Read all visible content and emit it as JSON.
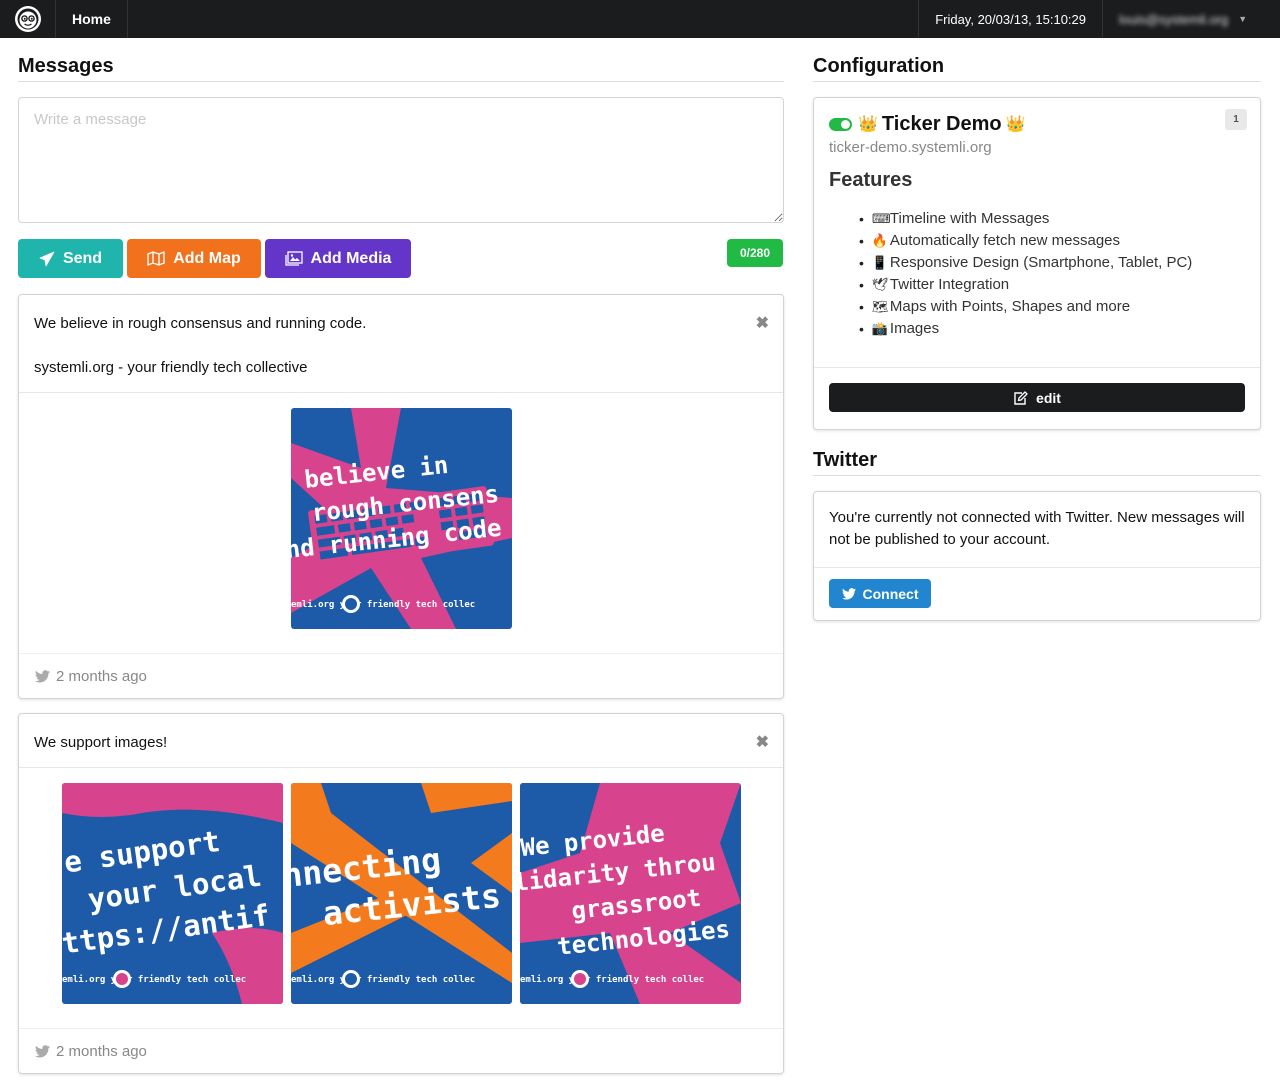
{
  "nav": {
    "home_label": "Home",
    "datetime": "Friday, 20/03/13, 15:10:29",
    "user_email": "louis@systemli.org",
    "logo_icon": "systemli-logo-icon"
  },
  "messages": {
    "title": "Messages",
    "placeholder": "Write a message",
    "send_label": "Send",
    "add_map_label": "Add Map",
    "add_media_label": "Add Media",
    "char_counter": "0/280",
    "colors": {
      "send": "#1fb5ac",
      "map": "#f2711c",
      "media": "#6435c9",
      "counter": "#21ba45"
    },
    "items": [
      {
        "line1": "We believe in rough consensus and running code.",
        "line2": "systemli.org - your friendly tech collective",
        "images": [
          {
            "lines": [
              "believe in",
              "rough consens",
              "nd running code"
            ],
            "footer": "emli.org  your friendly tech collec"
          }
        ],
        "time": "2 months ago"
      },
      {
        "line1": "We support images!",
        "images": [
          {
            "lines": [
              "Ve support",
              "your local",
              "ttps://antif"
            ],
            "footer": "emli.org  your friendly tech collec"
          },
          {
            "lines": [
              "nnecting",
              "activists"
            ],
            "footer": "emli.org  your friendly tech collec"
          },
          {
            "lines": [
              "We provide",
              "lidarity throu",
              "grassroot",
              "technologies"
            ],
            "footer": "emli.org  your friendly tech collec"
          }
        ],
        "time": "2 months ago"
      }
    ]
  },
  "configuration": {
    "title": "Configuration",
    "ticker_name": "Ticker Demo",
    "ticker_domain": "ticker-demo.systemli.org",
    "badge": "1",
    "features_title": "Features",
    "features": [
      {
        "icon": "⌨",
        "label": "Timeline with Messages"
      },
      {
        "icon": "🔥",
        "label": "Automatically fetch new messages"
      },
      {
        "icon": "📱",
        "label": "Responsive Design (Smartphone, Tablet, PC)"
      },
      {
        "icon": "🕊",
        "label": "Twitter Integration"
      },
      {
        "icon": "🗺",
        "label": "Maps with Points, Shapes and more"
      },
      {
        "icon": "📸",
        "label": "Images"
      }
    ],
    "edit_label": "edit",
    "active_color": "#21ba45"
  },
  "twitter": {
    "title": "Twitter",
    "status_text": "You're currently not connected with Twitter. New messages will not be published to your account.",
    "connect_label": "Connect",
    "connect_color": "#2185d0"
  }
}
